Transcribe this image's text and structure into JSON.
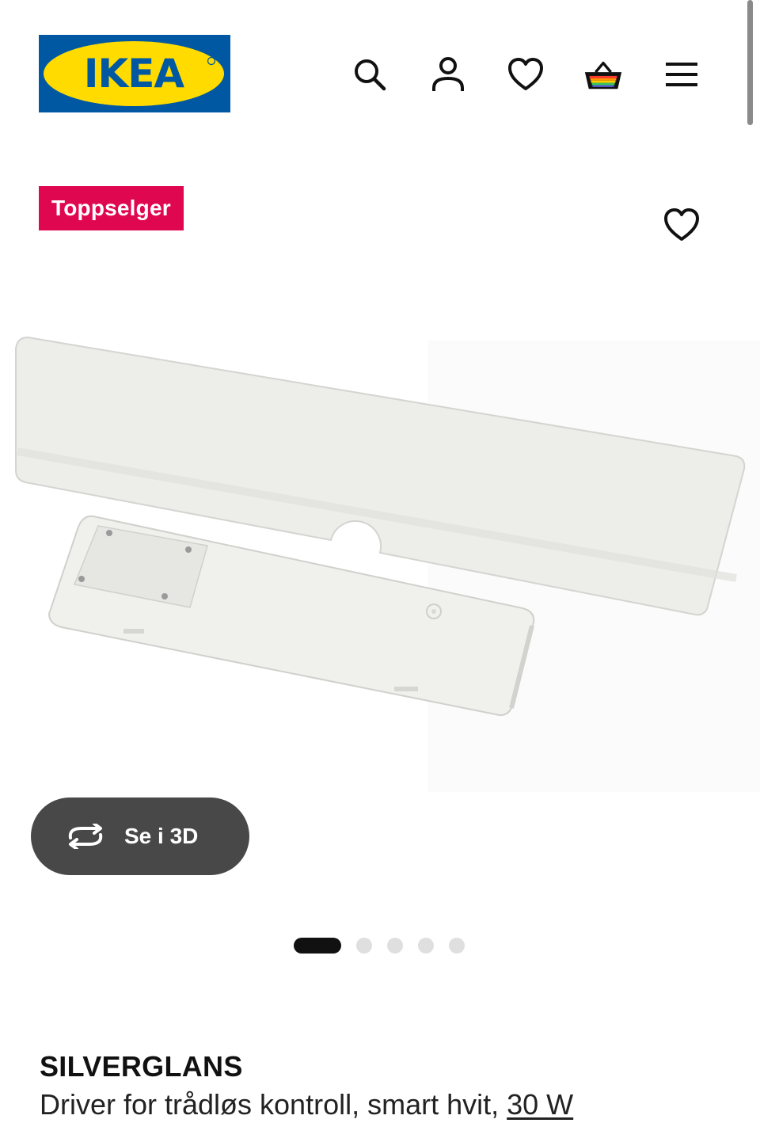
{
  "header": {
    "logo_text": "IKEA",
    "nav_icons": [
      "search-icon",
      "user-icon",
      "heart-icon",
      "basket-icon",
      "menu-icon"
    ]
  },
  "product": {
    "badge": "Toppselger",
    "view_3d_label": "Se i 3D",
    "carousel": {
      "total": 5,
      "active": 1
    },
    "name": "SILVERGLANS",
    "description": "Driver for trådløs kontroll, smart hvit,",
    "variant_link": "30 W"
  },
  "colors": {
    "brand_blue": "#0058a3",
    "brand_yellow": "#ffdb00",
    "badge_red": "#e00751",
    "button_dark": "#484848"
  }
}
